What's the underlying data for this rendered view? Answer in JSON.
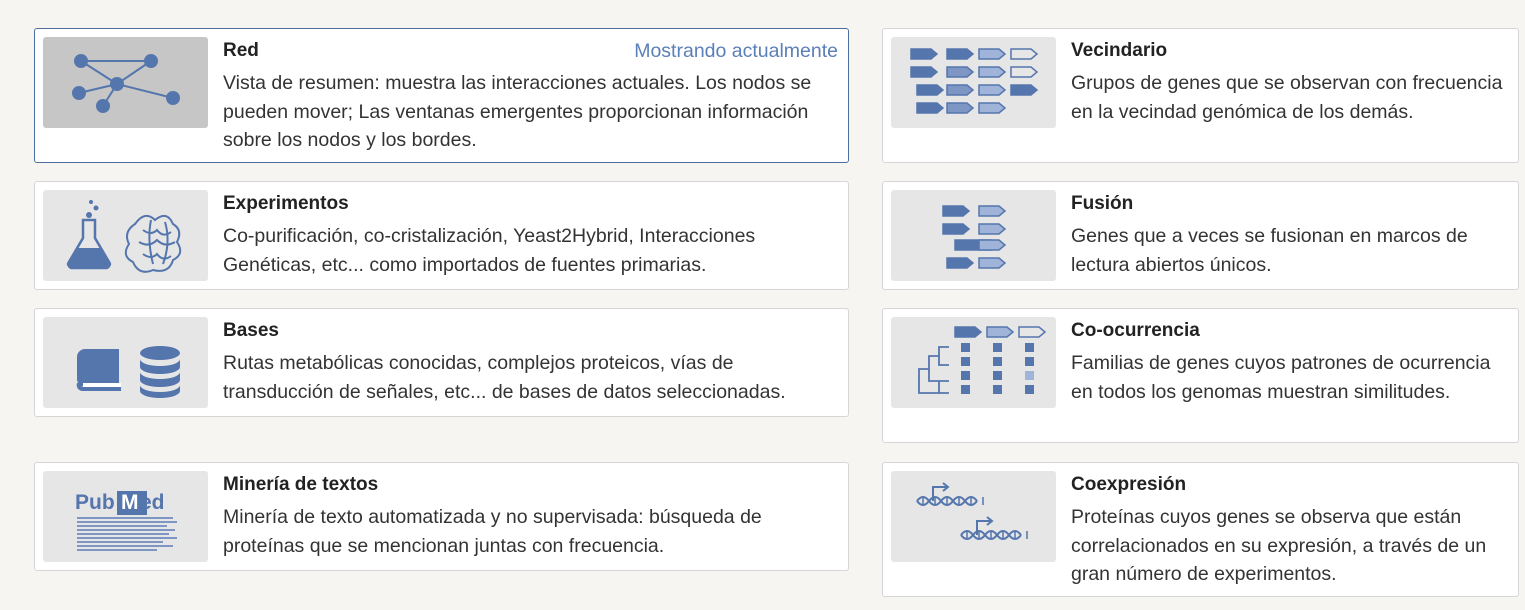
{
  "cards": [
    {
      "title": "Red",
      "status": "Mostrando actualmente",
      "description": "Vista de resumen: muestra las interacciones actuales. Los nodos se pueden mover; Las ventanas emergentes proporcionan información sobre los nodos y los bordes.",
      "icon": "network-graph-icon"
    },
    {
      "title": "Vecindario",
      "description": "Grupos de genes que se observan con frecuencia en la vecindad genómica de los demás.",
      "icon": "gene-neighborhood-icon"
    },
    {
      "title": "Experimentos",
      "description": "Co-purificación, co-cristalización, Yeast2Hybrid, Interacciones Genéticas, etc... como importados de fuentes primarias.",
      "icon": "flask-protein-icon"
    },
    {
      "title": "Fusión",
      "description": "Genes que a veces se fusionan en marcos de lectura abiertos únicos.",
      "icon": "gene-fusion-icon"
    },
    {
      "title": "Bases",
      "description": "Rutas metabólicas conocidas, complejos proteicos, vías de transducción de señales, etc... de bases de datos seleccionadas.",
      "icon": "book-database-icon"
    },
    {
      "title": "Co-ocurrencia",
      "description": "Familias de genes cuyos patrones de ocurrencia en todos los genomas muestran similitudes.",
      "icon": "phylogenetic-tree-icon"
    },
    {
      "title": "Minería de textos",
      "description": "Minería de texto automatizada y no supervisada: búsqueda de proteínas que se mencionan juntas con frecuencia.",
      "icon": "pubmed-icon",
      "logo_text": "PubMed"
    },
    {
      "title": "Coexpresión",
      "description": "Proteínas cuyos genes se observa que están correlacionados en su expresión, a través de un gran número de experimentos.",
      "icon": "dna-expression-icon"
    }
  ],
  "colors": {
    "accent": "#5b7fb8",
    "icon_blue": "#5576ad",
    "icon_light": "#9fb4d8",
    "card_border_active": "#4d6f9e",
    "thumb_bg": "#e6e6e7"
  }
}
